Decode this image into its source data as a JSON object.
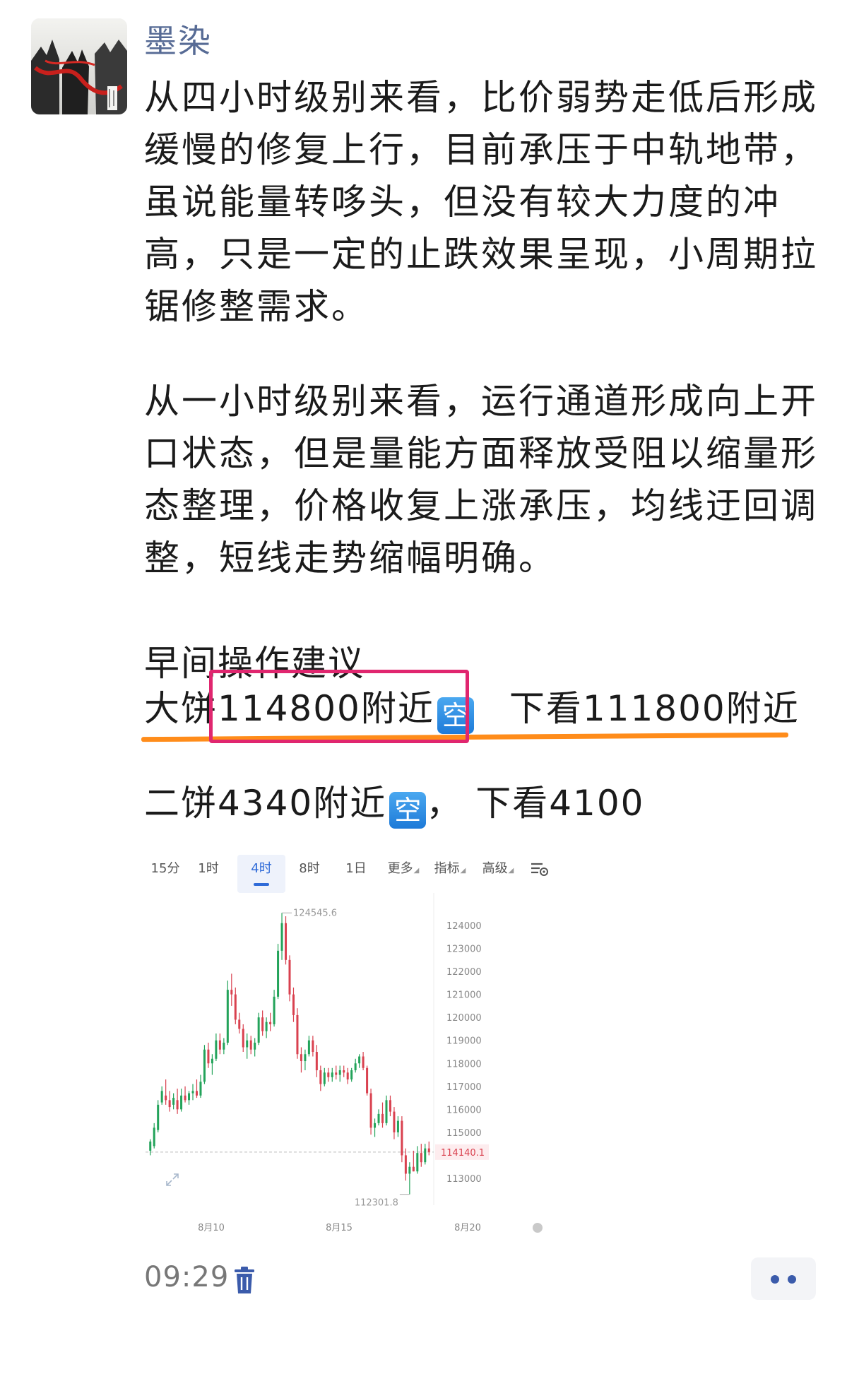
{
  "post": {
    "author": "墨染",
    "paragraph1": "从四小时级别来看，比价弱势走低后形成缓慢的修复上行，目前承压于中轨地带，虽说能量转哆头，但没有较大力度的冲高，只是一定的止跌效果呈现，小周期拉锯修整需求。",
    "paragraph2": "从一小时级别来看，运行通道形成向上开口状态，但是量能方面释放受阻以缩量形态整理，价格收复上涨承压，均线迂回调整，短线走势缩幅明确。",
    "advice_title": "早间操作建议",
    "big_cake": {
      "label": "大饼",
      "price": "114800附近",
      "tag": "空",
      "target": "下看111800附近"
    },
    "second_cake": {
      "label": "二饼",
      "price": "4340附近",
      "tag": "空",
      "separator": "，",
      "target": "下看4100"
    },
    "time": "09:29"
  },
  "chart": {
    "tabs": [
      "15分",
      "1时",
      "4时",
      "8时",
      "1日",
      "更多",
      "指标",
      "高级"
    ],
    "active_tab": "4时"
  },
  "chart_data": {
    "type": "candlestick",
    "x_ticks": [
      "8月10",
      "8月15",
      "8月20"
    ],
    "y_ticks": [
      113000,
      114000,
      115000,
      116000,
      117000,
      118000,
      119000,
      120000,
      121000,
      122000,
      123000,
      124000
    ],
    "y_range": [
      112200,
      124800
    ],
    "high_label": "124545.6",
    "low_label": "112301.8",
    "current_price": "114140.1",
    "candles": [
      [
        114200,
        114700,
        114000,
        114600
      ],
      [
        114400,
        115400,
        114300,
        115200
      ],
      [
        115100,
        116400,
        115000,
        116200
      ],
      [
        116300,
        117000,
        116200,
        116800
      ],
      [
        116600,
        117300,
        116200,
        116400
      ],
      [
        116400,
        116800,
        115900,
        116100
      ],
      [
        116200,
        116700,
        116000,
        116500
      ],
      [
        116400,
        116900,
        115800,
        116000
      ],
      [
        116000,
        116900,
        115900,
        116600
      ],
      [
        116600,
        117000,
        116300,
        116400
      ],
      [
        116400,
        116800,
        116200,
        116700
      ],
      [
        116700,
        117100,
        116400,
        116800
      ],
      [
        116800,
        117300,
        116500,
        116600
      ],
      [
        116600,
        117500,
        116500,
        117200
      ],
      [
        117200,
        118800,
        117100,
        118600
      ],
      [
        118600,
        118900,
        117800,
        118000
      ],
      [
        118000,
        118400,
        117500,
        118200
      ],
      [
        118200,
        119300,
        118100,
        119000
      ],
      [
        119000,
        119300,
        118400,
        118600
      ],
      [
        118600,
        119100,
        118400,
        118900
      ],
      [
        118900,
        121600,
        118800,
        121200
      ],
      [
        121200,
        121900,
        120500,
        121000
      ],
      [
        121000,
        121300,
        119700,
        119900
      ],
      [
        119900,
        120200,
        119300,
        119500
      ],
      [
        119500,
        119700,
        118500,
        118700
      ],
      [
        118700,
        119300,
        118200,
        119000
      ],
      [
        119000,
        119200,
        118400,
        118600
      ],
      [
        118600,
        119100,
        118300,
        118900
      ],
      [
        118900,
        120200,
        118800,
        120000
      ],
      [
        120000,
        120300,
        119200,
        119400
      ],
      [
        119400,
        120000,
        119100,
        119800
      ],
      [
        119800,
        120200,
        119400,
        119700
      ],
      [
        119700,
        121200,
        119600,
        120900
      ],
      [
        120900,
        123200,
        120800,
        122900
      ],
      [
        122900,
        124545.6,
        122500,
        124100
      ],
      [
        124100,
        124400,
        122300,
        122500
      ],
      [
        122500,
        122700,
        120700,
        121000
      ],
      [
        121000,
        121300,
        119800,
        120100
      ],
      [
        120100,
        120400,
        118200,
        118400
      ],
      [
        118400,
        118700,
        117600,
        118100
      ],
      [
        118100,
        118600,
        117700,
        118400
      ],
      [
        118400,
        119200,
        118300,
        119000
      ],
      [
        119000,
        119200,
        118300,
        118500
      ],
      [
        118500,
        118800,
        117400,
        117700
      ],
      [
        117700,
        117900,
        116800,
        117100
      ],
      [
        117100,
        117800,
        117000,
        117600
      ],
      [
        117600,
        117800,
        117200,
        117400
      ],
      [
        117400,
        117800,
        117200,
        117600
      ],
      [
        117600,
        117900,
        117300,
        117500
      ],
      [
        117500,
        117900,
        117200,
        117700
      ],
      [
        117700,
        117900,
        117400,
        117600
      ],
      [
        117600,
        117800,
        117100,
        117300
      ],
      [
        117300,
        117800,
        117200,
        117700
      ],
      [
        117700,
        118200,
        117600,
        118000
      ],
      [
        118000,
        118400,
        117800,
        118300
      ],
      [
        118300,
        118500,
        117700,
        117800
      ],
      [
        117800,
        117900,
        116600,
        116700
      ],
      [
        116700,
        116900,
        114900,
        115200
      ],
      [
        115200,
        115600,
        114800,
        115400
      ],
      [
        115400,
        116000,
        115300,
        115800
      ],
      [
        115800,
        116300,
        115200,
        115400
      ],
      [
        115400,
        116600,
        115300,
        116400
      ],
      [
        116400,
        116600,
        115700,
        115900
      ],
      [
        115900,
        116100,
        114700,
        115000
      ],
      [
        115000,
        115700,
        114800,
        115500
      ],
      [
        115500,
        115700,
        113700,
        114000
      ],
      [
        114000,
        114300,
        112900,
        113200
      ],
      [
        113200,
        113700,
        112301.8,
        113500
      ],
      [
        113500,
        114200,
        113300,
        113300
      ],
      [
        113300,
        114400,
        113200,
        114100
      ],
      [
        114100,
        114500,
        113500,
        113700
      ],
      [
        113700,
        114500,
        113600,
        114300
      ],
      [
        114300,
        114600,
        114000,
        114140.1
      ]
    ]
  }
}
